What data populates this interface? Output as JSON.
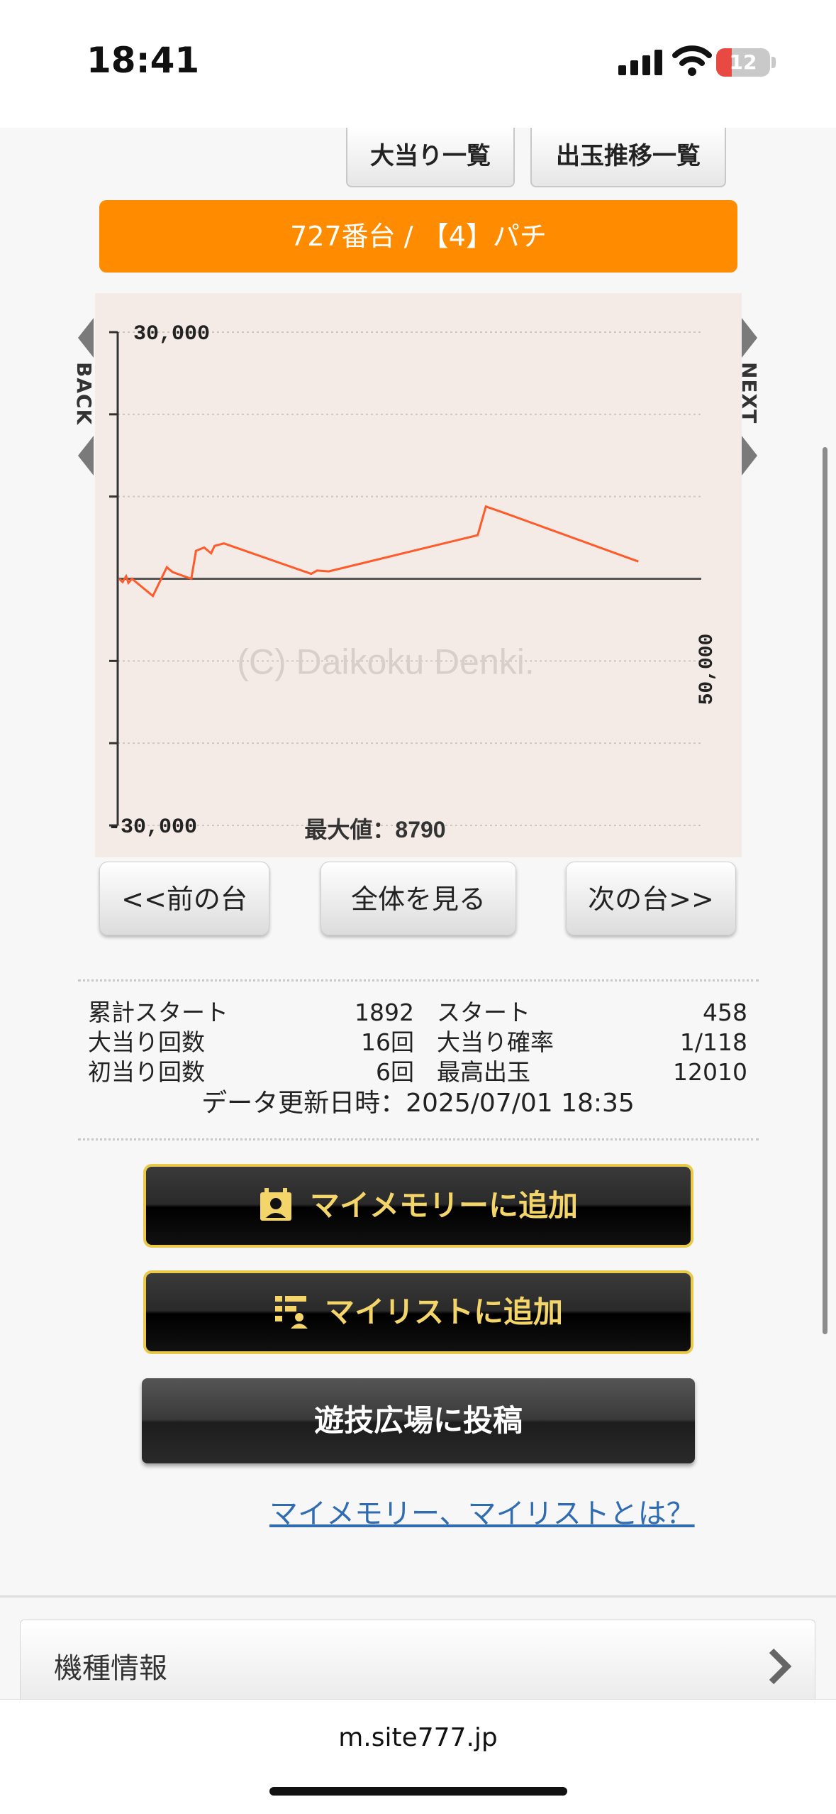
{
  "status_bar": {
    "time": "18:41",
    "battery": "12"
  },
  "top_tabs": {
    "jackpot_list": "大当り一覧",
    "payout_list": "出玉推移一覧"
  },
  "machine_title": "727番台 / 【4】パチ",
  "chart_data": {
    "type": "line",
    "title": "",
    "ylim": [
      -30000,
      30000
    ],
    "ytick_labels": [
      "30,000",
      "-30,000"
    ],
    "x_tick_label": "50,000",
    "watermark": "(C) Daikoku Denki.",
    "max_label": "最大値：8790",
    "series": [
      {
        "color": "#ff5a2a",
        "x": [
          0,
          300,
          600,
          800,
          1100,
          2900,
          4100,
          4600,
          6200,
          6600,
          7300,
          7900,
          8200,
          9000,
          16500,
          17000,
          18000,
          30800,
          31500,
          33100,
          44600
        ],
        "y": [
          0,
          -400,
          300,
          -500,
          0,
          -2100,
          1400,
          800,
          0,
          3400,
          3800,
          3100,
          4000,
          4300,
          600,
          1000,
          900,
          5300,
          8790,
          8000,
          2100
        ]
      }
    ]
  },
  "graph_nav": {
    "back": "BACK",
    "next": "NEXT"
  },
  "nav_buttons": {
    "prev": "<<前の台",
    "all": "全体を見る",
    "next": "次の台>>"
  },
  "stats": {
    "cum_start_label": "累計スタート",
    "cum_start_value": "1892",
    "start_label": "スタート",
    "start_value": "458",
    "jackpots_label": "大当り回数",
    "jackpots_value": "16回",
    "prob_label": "大当り確率",
    "prob_value": "1/118",
    "first_label": "初当り回数",
    "first_value": "6回",
    "max_payout_label": "最高出玉",
    "max_payout_value": "12010",
    "updated": "データ更新日時：2025/07/01 18:35"
  },
  "actions": {
    "add_memory": "マイメモリーに追加",
    "add_list": "マイリストに追加",
    "post": "遊技広場に投稿",
    "help_link": "マイメモリー、マイリストとは？"
  },
  "machine_info": {
    "label": "機種情報"
  },
  "browser": {
    "url": "m.site777.jp"
  }
}
